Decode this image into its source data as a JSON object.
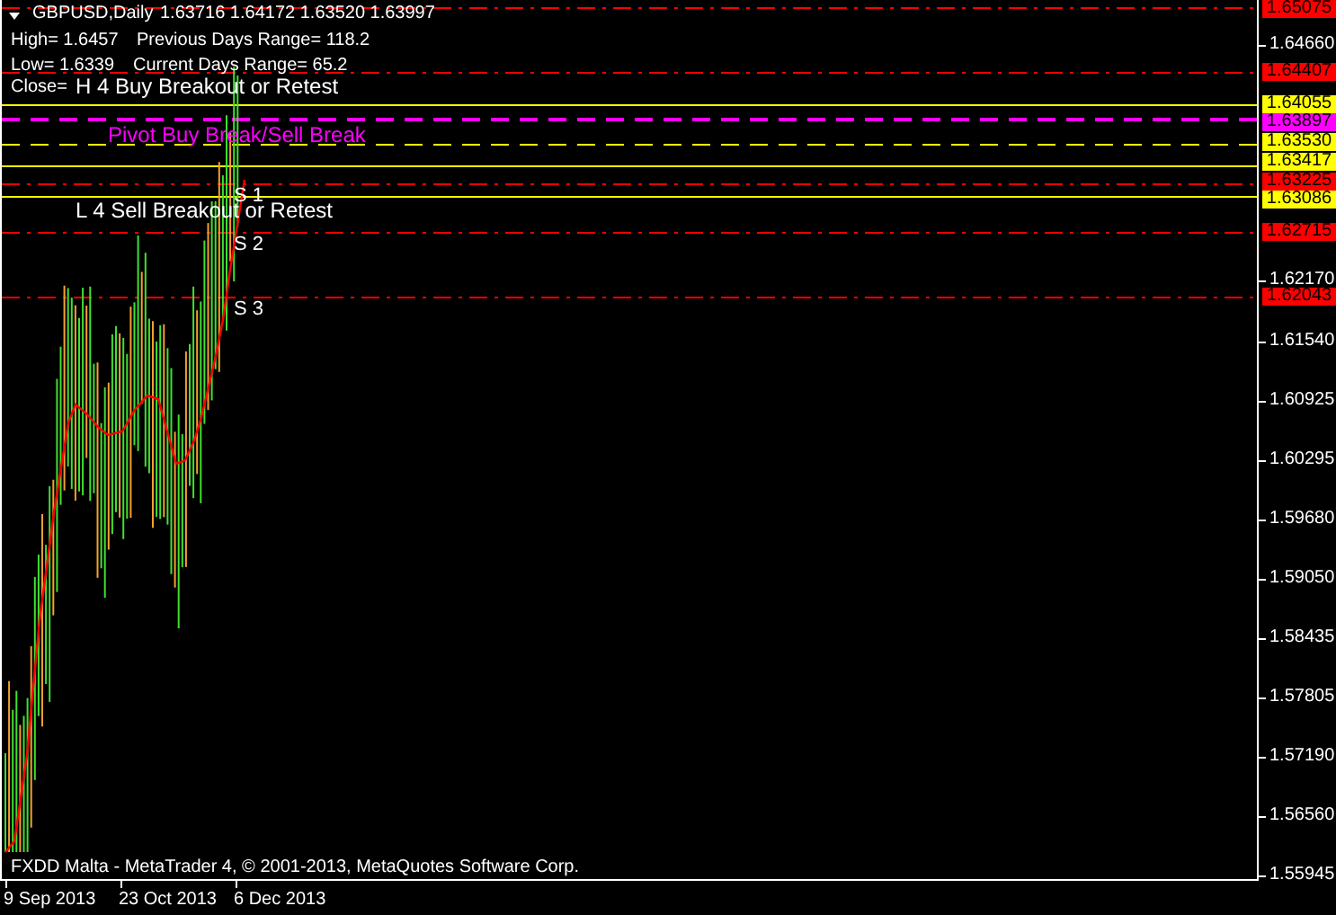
{
  "chart_header": {
    "symbol": "GBPUSD,Daily",
    "ohlc": "1.63716 1.64172 1.63520 1.63997"
  },
  "info": [
    {
      "text": "High= 1.6457"
    },
    {
      "text": "Previous Days Range= 118.2"
    },
    {
      "text": "Low= 1.6339"
    },
    {
      "text": "Current Days Range= 65.2"
    },
    {
      "text": "Close="
    }
  ],
  "chart_labels": [
    {
      "text": "H 4 Buy Breakout or Retest",
      "color": "#ffffff"
    },
    {
      "text": "Pivot Buy Break/Sell Break",
      "color": "#ff00ff"
    },
    {
      "text": "L 4 Sell Breakout or Retest",
      "color": "#ffffff"
    },
    {
      "text": "S 1",
      "color": "#ffffff"
    },
    {
      "text": "S 2",
      "color": "#ffffff"
    },
    {
      "text": "S 3",
      "color": "#ffffff"
    }
  ],
  "price_levels": [
    {
      "price": "1.65075",
      "color": "#ff0000"
    },
    {
      "price": "1.64407",
      "color": "#ff0000"
    },
    {
      "price": "1.64055",
      "color": "#ffff00"
    },
    {
      "price": "1.63897",
      "color": "#ff00ff"
    },
    {
      "price": "1.63530",
      "color": "#ffff00"
    },
    {
      "price": "1.63417",
      "color": "#ffff00"
    },
    {
      "price": "1.63225",
      "color": "#ff0000"
    },
    {
      "price": "1.63086",
      "color": "#ffff00"
    },
    {
      "price": "1.62715",
      "color": "#ff0000"
    },
    {
      "price": "1.62043",
      "color": "#ff0000"
    }
  ],
  "price_axis": {
    "ticks": [
      "1.64660",
      "1.62170",
      "1.61540",
      "1.60925",
      "1.60295",
      "1.59680",
      "1.59050",
      "1.58435",
      "1.57805",
      "1.57190",
      "1.56560",
      "1.55945"
    ]
  },
  "time_axis": {
    "ticks": [
      "9 Sep 2013",
      "23 Oct 2013",
      "6 Dec 2013"
    ]
  },
  "footer": "FXDD Malta - MetaTrader 4, © 2001-2013, MetaQuotes Software Corp."
}
